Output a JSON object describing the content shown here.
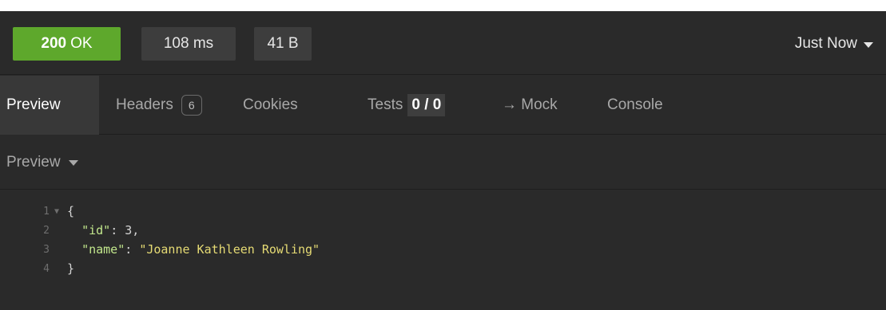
{
  "status": {
    "code": "200",
    "text": "OK",
    "time": "108 ms",
    "size": "41 B",
    "timestamp": "Just Now"
  },
  "tabs": {
    "preview": "Preview",
    "headers": "Headers",
    "headers_count": "6",
    "cookies": "Cookies",
    "tests": "Tests",
    "tests_score": "0 / 0",
    "mock": "→ Mock",
    "console": "Console"
  },
  "preview_mode": {
    "label": "Preview"
  },
  "response_body": {
    "lines": [
      {
        "num": "1",
        "open": "{"
      },
      {
        "num": "2",
        "key": "\"id\"",
        "value": "3"
      },
      {
        "num": "3",
        "key": "\"name\"",
        "value": "\"Joanne Kathleen Rowling\""
      },
      {
        "num": "4",
        "close": "}"
      }
    ]
  },
  "colors": {
    "success": "#5ea82c",
    "panel_bg": "#2a2a2a",
    "json_key": "#c3e88d",
    "json_string": "#e6db74"
  },
  "icons": {
    "timestamp_dropdown": "caret-down-icon",
    "mode_dropdown": "caret-down-icon",
    "fold": "fold-triangle-icon"
  }
}
